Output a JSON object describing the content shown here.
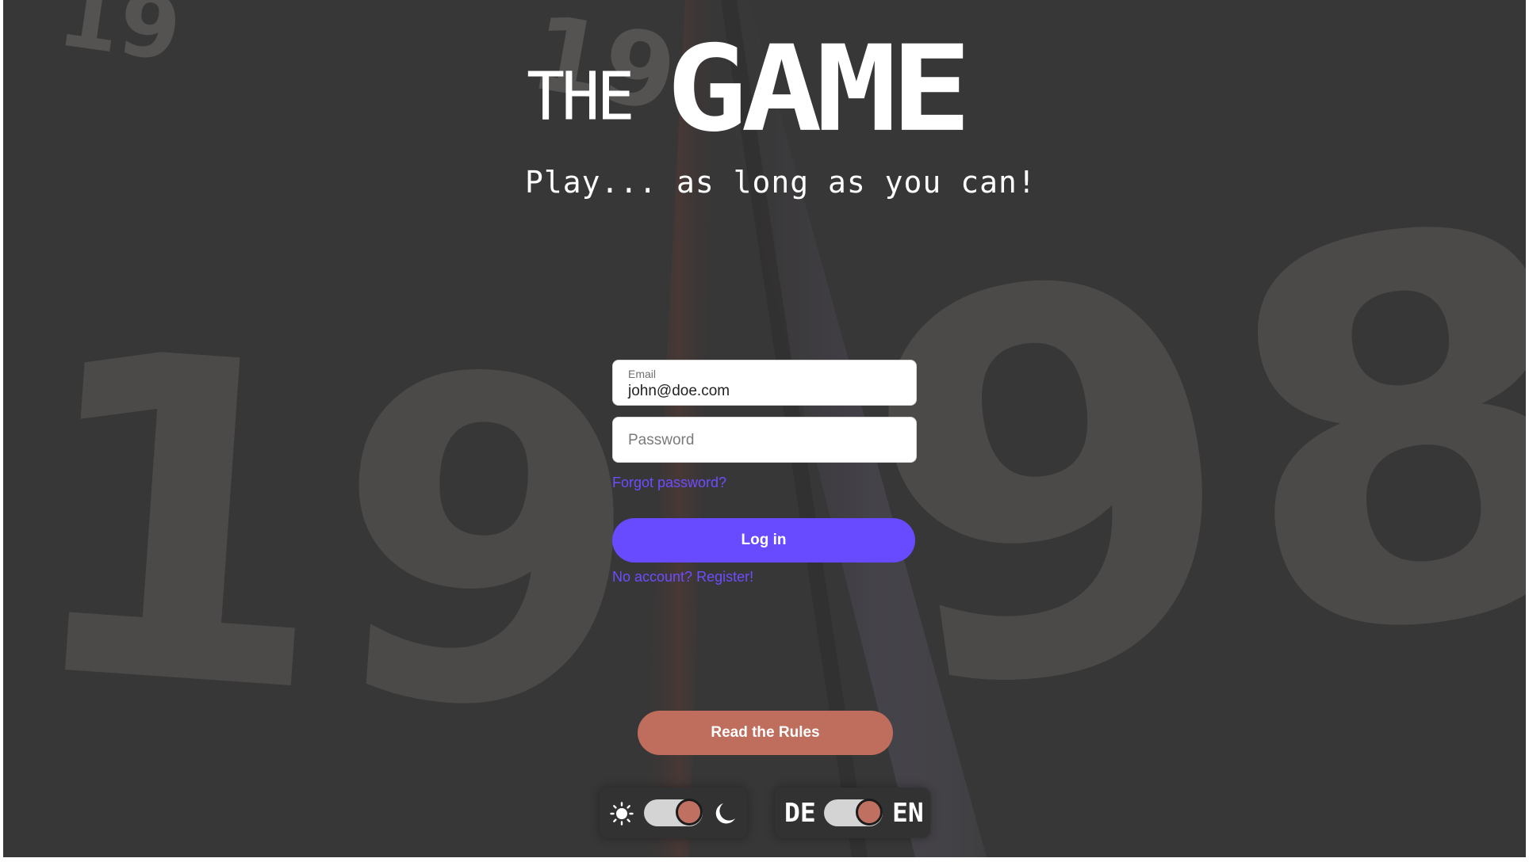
{
  "brand": {
    "title_small": "THE",
    "title_large": "GAME",
    "tagline": "Play... as long as you can!"
  },
  "background": {
    "decorative_numbers": [
      "19",
      "19",
      "19",
      "98"
    ]
  },
  "login": {
    "email_label": "Email",
    "email_value": "john@doe.com",
    "password_placeholder": "Password",
    "forgot_password": "Forgot password?",
    "login_button": "Log in",
    "register_link": "No account? Register!"
  },
  "rules_button": "Read the Rules",
  "theme_toggle": {
    "left_icon": "sun-icon",
    "right_icon": "moon-icon",
    "state": "dark"
  },
  "language_toggle": {
    "left_label": "DE",
    "right_label": "EN",
    "state": "EN"
  },
  "colors": {
    "background": "#383737",
    "accent_primary": "#684aff",
    "accent_secondary": "#bf6d5c"
  }
}
